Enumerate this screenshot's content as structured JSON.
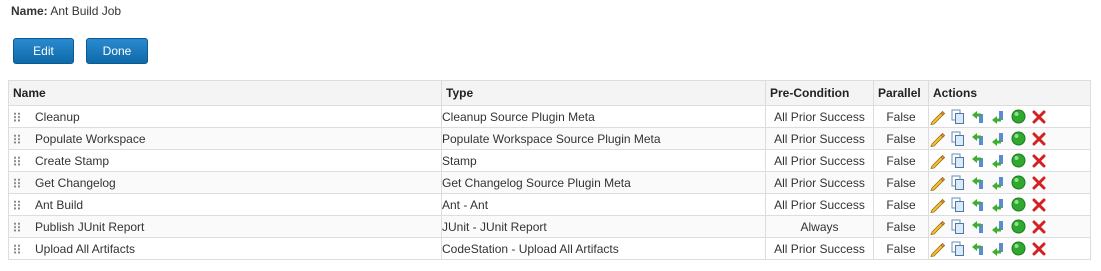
{
  "job": {
    "name_label": "Name:",
    "name_value": "Ant Build Job"
  },
  "buttons": {
    "edit": "Edit",
    "done": "Done"
  },
  "columns": {
    "name": "Name",
    "type": "Type",
    "precondition": "Pre-Condition",
    "parallel": "Parallel",
    "actions": "Actions"
  },
  "steps": [
    {
      "name": "Cleanup",
      "type": "Cleanup Source Plugin Meta",
      "precondition": "All Prior Success",
      "parallel": "False"
    },
    {
      "name": "Populate Workspace",
      "type": "Populate Workspace Source Plugin Meta",
      "precondition": "All Prior Success",
      "parallel": "False"
    },
    {
      "name": "Create Stamp",
      "type": "Stamp",
      "precondition": "All Prior Success",
      "parallel": "False"
    },
    {
      "name": "Get Changelog",
      "type": "Get Changelog Source Plugin Meta",
      "precondition": "All Prior Success",
      "parallel": "False"
    },
    {
      "name": "Ant Build",
      "type": "Ant - Ant",
      "precondition": "All Prior Success",
      "parallel": "False"
    },
    {
      "name": "Publish JUnit Report",
      "type": "JUnit - JUnit Report",
      "precondition": "Always",
      "parallel": "False"
    },
    {
      "name": "Upload All Artifacts",
      "type": "CodeStation - Upload All Artifacts",
      "precondition": "All Prior Success",
      "parallel": "False"
    }
  ],
  "row_actions": [
    "pencil-icon",
    "copy-icon",
    "insert-before-icon",
    "insert-after-icon",
    "activate-icon",
    "delete-icon"
  ],
  "colors": {
    "button_bg": "#1a78bd",
    "delete": "#d42020",
    "activate": "#2fa82f"
  }
}
